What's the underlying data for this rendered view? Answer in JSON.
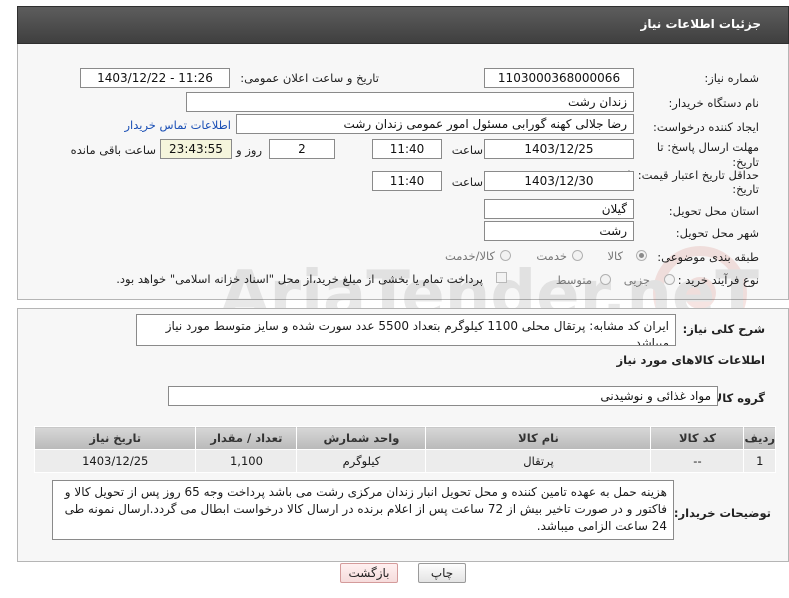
{
  "header": {
    "title": "جزئیات اطلاعات نیاز"
  },
  "form": {
    "need_number_label": "شماره نیاز:",
    "need_number": "1103000368000066",
    "announce_label": "تاریخ و ساعت اعلان عمومی:",
    "announce_value": "1403/12/22 - 11:26",
    "buyer_org_label": "نام دستگاه خریدار:",
    "buyer_org": "زندان رشت",
    "requester_label": "ایجاد کننده درخواست:",
    "requester": "رضا جلالی کهنه گورابی مسئول امور عمومی زندان رشت",
    "contact_link": "اطلاعات تماس خریدار",
    "deadline_label_1": "مهلت ارسال پاسخ: تا",
    "deadline_label_2": "تاریخ:",
    "deadline_date": "1403/12/25",
    "time_label": "ساعت",
    "deadline_time": "11:40",
    "days_value": "2",
    "days_label": "روز و",
    "remaining_time": "23:43:55",
    "remaining_label": "ساعت باقی مانده",
    "validity_label_1": "حداقل تاریخ اعتبار قیمت: تا",
    "validity_label_2": "تاریخ:",
    "validity_date": "1403/12/30",
    "validity_time": "11:40",
    "province_label": "استان محل تحویل:",
    "province": "گیلان",
    "city_label": "شهر محل تحویل:",
    "city": "رشت",
    "category_label": "طبقه بندی موضوعی:",
    "category_options": [
      "کالا",
      "خدمت",
      "کالا/خدمت"
    ],
    "process_label": "نوع فرآیند خرید :",
    "process_options": [
      "جزیی",
      "متوسط"
    ],
    "payment_note": "پرداخت تمام یا بخشی از مبلغ خرید،از محل \"اسناد خزانه اسلامی\" خواهد بود."
  },
  "description": {
    "label": "شرح کلی نیاز:",
    "text": "ایران کد مشابه: پرتقال محلی 1100 کیلوگرم بتعداد 5500 عدد سورت شده و سایز متوسط مورد نیاز میباشد ."
  },
  "goods": {
    "section_title": "اطلاعات کالاهای مورد نیاز",
    "group_label": "گروه کالا:",
    "group_value": "مواد غذائی و نوشیدنی",
    "columns": [
      "ردیف",
      "کد کالا",
      "نام کالا",
      "واحد شمارش",
      "تعداد / مقدار",
      "تاریخ نیاز"
    ],
    "rows": [
      {
        "row": "1",
        "code": "--",
        "name": "پرتقال",
        "unit": "کیلوگرم",
        "qty": "1,100",
        "date": "1403/12/25"
      }
    ]
  },
  "buyer_notes": {
    "label": "توضیحات خریدار:",
    "text": "هزینه حمل به عهده تامین کننده و محل تحویل انبار زندان مرکزی رشت می باشد پرداخت وجه 65 روز پس از تحویل کالا و فاکتور و در صورت تاخیر بیش از 72 ساعت پس از اعلام برنده در ارسال کالا درخواست ابطال می گردد.ارسال نمونه طی 24 ساعت الزامی میباشد."
  },
  "buttons": {
    "print": "چاپ",
    "back": "بازگشت"
  },
  "watermark": {
    "text": "AriaTender.neT"
  },
  "colors": {
    "header": "#4a4a4a",
    "link": "#1a4fb5",
    "panel": "#f7f7f7"
  }
}
